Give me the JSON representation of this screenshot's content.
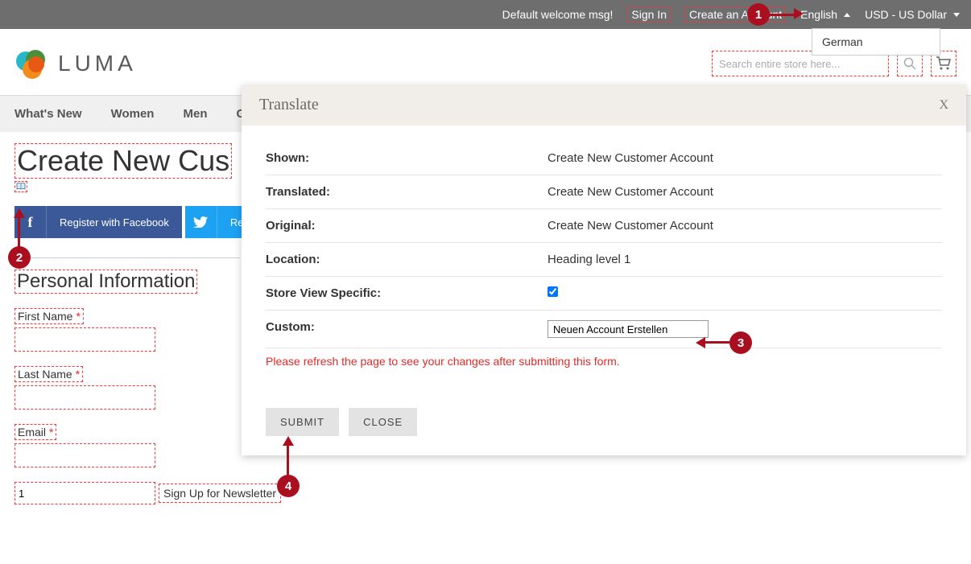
{
  "top": {
    "welcome": "Default welcome msg!",
    "sign_in": "Sign In",
    "create_account": "Create an Account",
    "language": "English",
    "currency": "USD - US Dollar",
    "lang_option": "German"
  },
  "brand": "LUMA",
  "search": {
    "placeholder": "Search entire store here..."
  },
  "nav": {
    "whats_new": "What's New",
    "women": "Women",
    "men": "Men",
    "gear_partial": "Ge"
  },
  "page": {
    "title_partial": "Create New Cus",
    "social_fb": "Register with Facebook",
    "social_tw": "Register w",
    "section": "Personal Information",
    "first_name": "First Name",
    "last_name": "Last Name",
    "email": "Email",
    "newsletter_value": "1",
    "newsletter_label": "Sign Up for Newsletter"
  },
  "modal": {
    "title": "Translate",
    "rows": {
      "shown_label": "Shown:",
      "shown_value": "Create New Customer Account",
      "translated_label": "Translated:",
      "translated_value": "Create New Customer Account",
      "original_label": "Original:",
      "original_value": "Create New Customer Account",
      "location_label": "Location:",
      "location_value": "Heading level 1",
      "store_view_label": "Store View Specific:",
      "custom_label": "Custom:",
      "custom_value": "Neuen Account Erstellen"
    },
    "warning": "Please refresh the page to see your changes after submitting this form.",
    "submit": "SUBMIT",
    "close_btn": "CLOSE",
    "close_x": "X"
  },
  "markers": {
    "m1": "1",
    "m2": "2",
    "m3": "3",
    "m4": "4"
  }
}
